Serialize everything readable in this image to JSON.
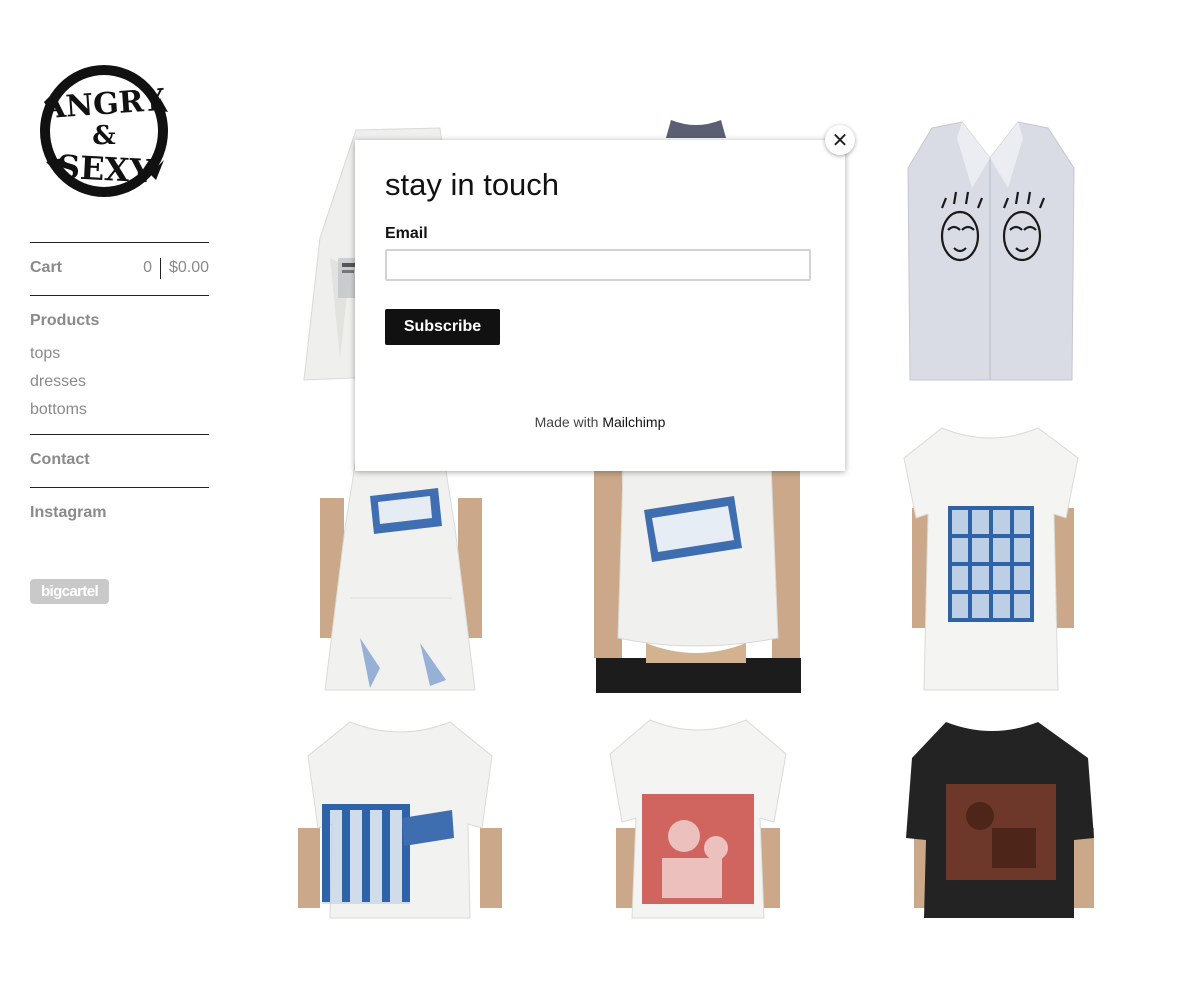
{
  "brand": {
    "logo_text": "ANGRY & SEXY"
  },
  "cart": {
    "label": "Cart",
    "count": "0",
    "total": "$0.00"
  },
  "nav": {
    "products": "Products",
    "categories": [
      "tops",
      "dresses",
      "bottoms"
    ],
    "contact": "Contact",
    "instagram": "Instagram"
  },
  "badge": "bigcartel",
  "popup": {
    "title": "stay in touch",
    "email_label": "Email",
    "email_value": "",
    "subscribe_label": "Subscribe",
    "made_with_prefix": "Made with",
    "made_with_brand": "Mailchimp",
    "close_glyph": "✕"
  },
  "colors": {
    "nav_text": "#8a8a8a",
    "button_bg": "#111111",
    "cyanotype_blue": "#2f63a8",
    "print_red": "#c94a45"
  },
  "products": [
    {
      "kind": "skirt",
      "garment_color": "#f0f0ee",
      "print": "doc"
    },
    {
      "kind": "hidden",
      "garment_color": "#e8e8ee",
      "print": "none"
    },
    {
      "kind": "shirt",
      "garment_color": "#d8dce6",
      "print": "faces"
    },
    {
      "kind": "dress",
      "garment_color": "#f3f3f1",
      "print": "blue-label"
    },
    {
      "kind": "tank",
      "garment_color": "#f1f1ef",
      "print": "blue-label"
    },
    {
      "kind": "tee",
      "garment_color": "#f4f4f2",
      "print": "blue-grid"
    },
    {
      "kind": "tee",
      "garment_color": "#f2f2f0",
      "print": "blue-bars"
    },
    {
      "kind": "tee",
      "garment_color": "#f4f4f2",
      "print": "red-photo"
    },
    {
      "kind": "tee",
      "garment_color": "#232323",
      "print": "rust-photo"
    }
  ]
}
